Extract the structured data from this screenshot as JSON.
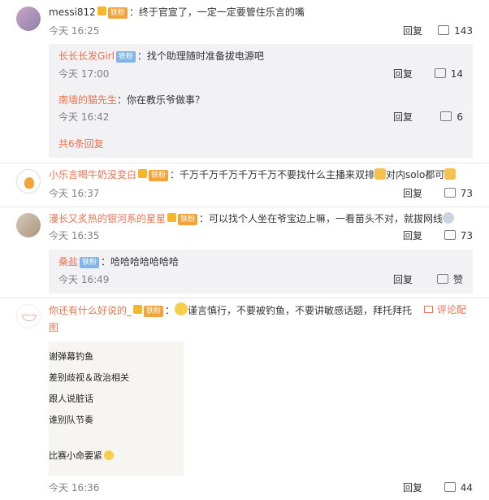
{
  "comments": [
    {
      "username": "messi812",
      "badge": "铁粉",
      "text": "：终于官宣了，一定一定要管住乐言的嘴",
      "time": "今天 16:25",
      "reply": "回复",
      "likes": "143",
      "replies": [
        {
          "username": "长长长发Girl",
          "badge": "铁粉",
          "text": "：找个助理随时准备拔电源吧",
          "time": "今天 17:00",
          "reply": "回复",
          "likes": "14"
        },
        {
          "username": "南墙的猫先生",
          "text": "：你在教乐爷做事？",
          "time": "今天 16:42",
          "reply": "回复",
          "likes": "6"
        }
      ],
      "more_replies": "共6条回复"
    },
    {
      "username": "小乐言喝牛奶没变白",
      "badge": "铁粉",
      "text": "：千万千万千万千万千万不要找什么主播来双排",
      "text2": "对内solo都可",
      "time": "今天 16:37",
      "reply": "回复",
      "likes": "73"
    },
    {
      "username": "漫长又炙热的银河系的星星",
      "badge": "铁粉",
      "text": "：可以找个人坐在爷宝边上嘛，一看苗头不对，就拔网线",
      "time": "今天 16:35",
      "reply": "回复",
      "likes": "73",
      "replies": [
        {
          "username": "桑盐",
          "badge": "铁粉",
          "text": "：哈哈哈哈哈哈哈",
          "time": "今天 16:49",
          "reply": "回复",
          "likes": "赞"
        }
      ]
    },
    {
      "username": "你还有什么好说的_",
      "badge": "铁粉",
      "text": "谨言慎行，不要被钓鱼，不要讲敏感话题，拜托拜托",
      "attach_label": "评论配",
      "attach_label2": "图",
      "image_lines": [
        "谢弹幕钓鱼",
        "差别歧视＆政治相关",
        "跟人说脏话",
        "谁别队节奏",
        "比赛小命要紧"
      ],
      "time": "今天 16:36",
      "reply": "回复",
      "likes": "44"
    }
  ]
}
